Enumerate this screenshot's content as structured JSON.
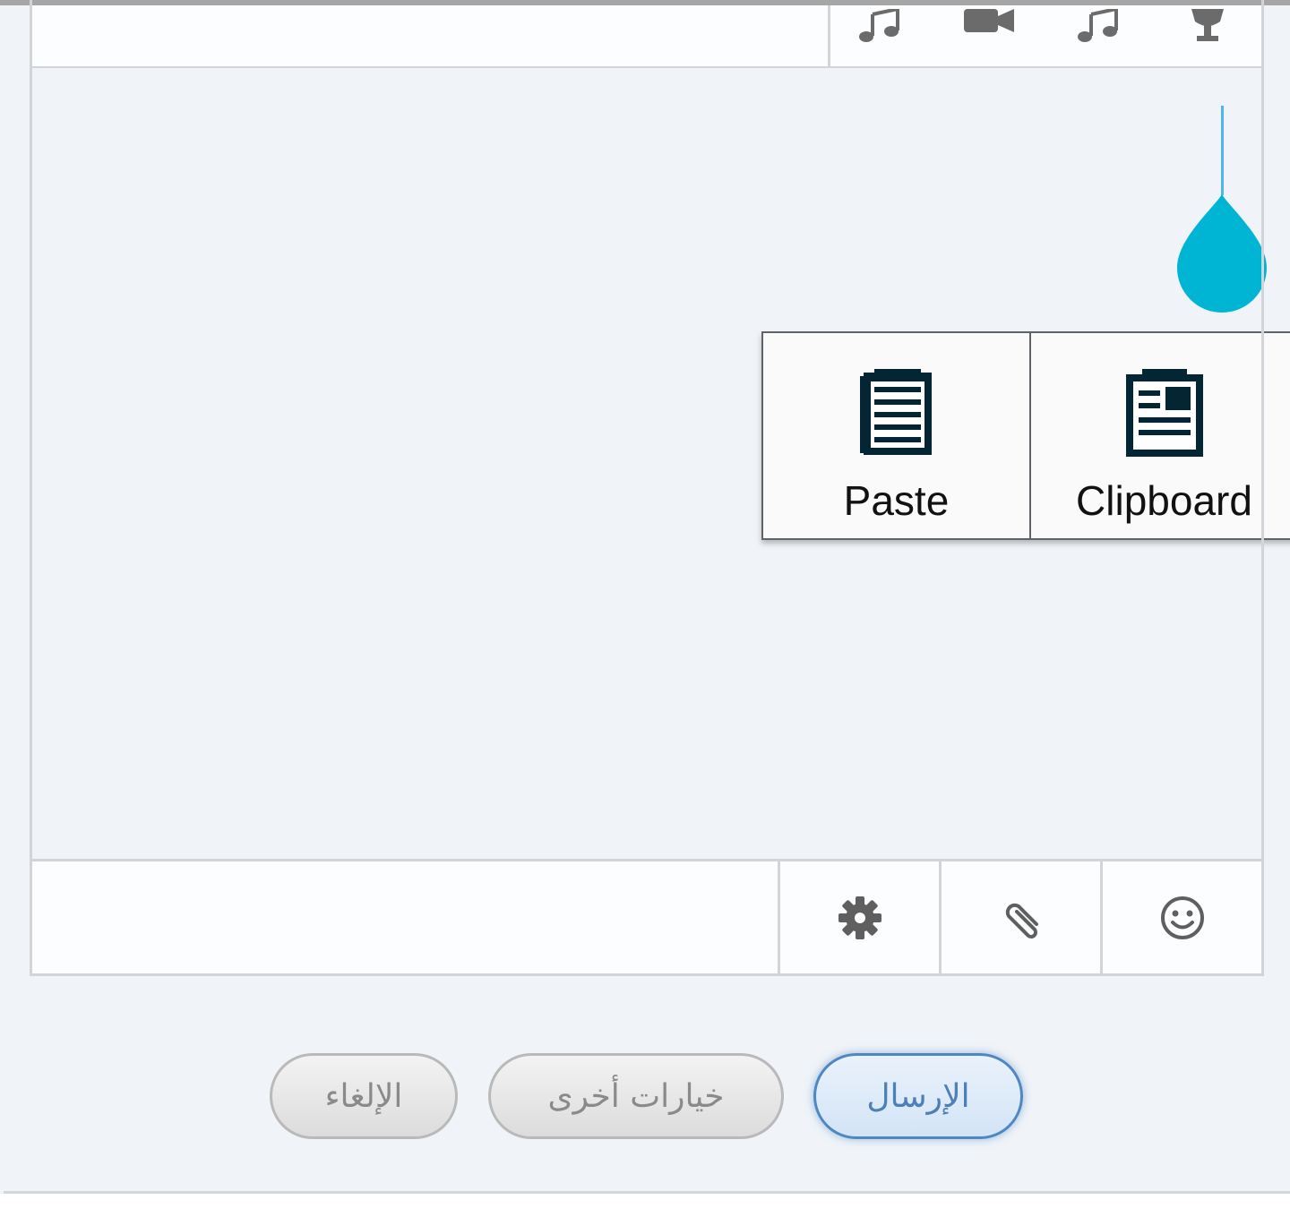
{
  "attach_bar": {
    "icons": [
      "music-note-icon",
      "video-camera-icon",
      "music-note-icon",
      "trophy-icon"
    ]
  },
  "context_menu": {
    "paste_label": "Paste",
    "clipboard_label": "Clipboard"
  },
  "toolbar": {
    "icons": [
      "gear-icon",
      "paperclip-icon",
      "smiley-icon"
    ]
  },
  "buttons": {
    "send": "الإرسال",
    "more_options": "خيارات أخرى",
    "cancel": "الإلغاء"
  },
  "colors": {
    "accent_cursor": "#4fb5ef",
    "selection_handle": "#00b5d4",
    "send_border": "#4f87c3"
  }
}
